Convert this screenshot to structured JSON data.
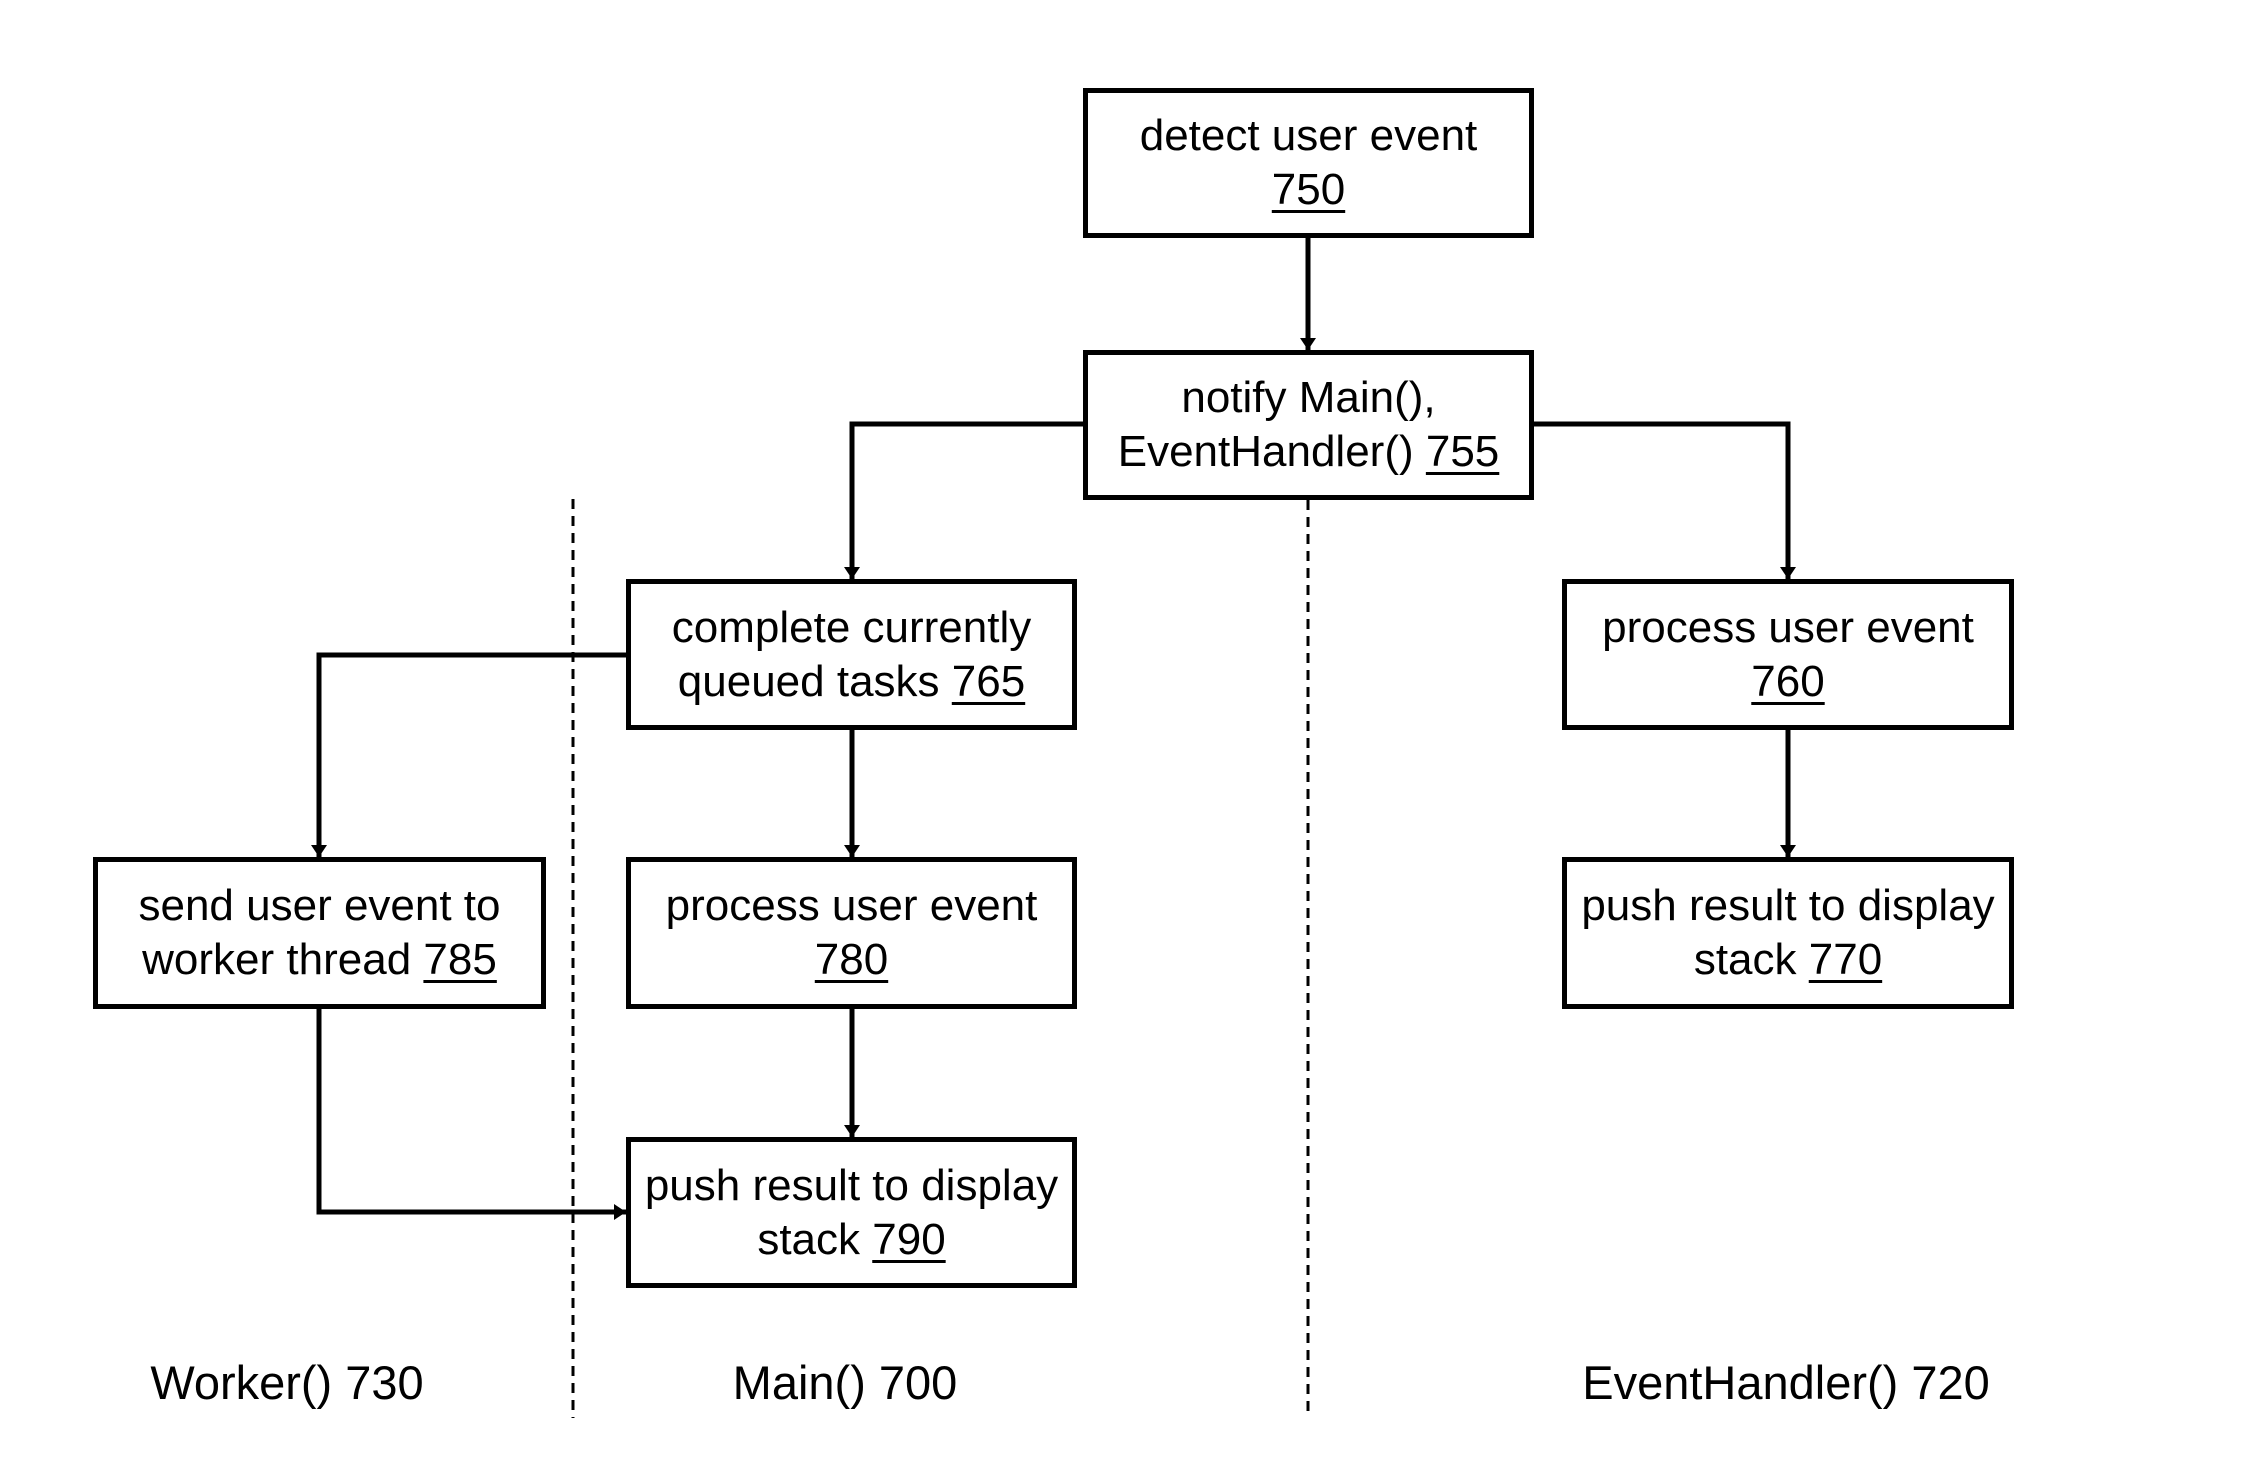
{
  "diagram": {
    "type": "flowchart",
    "colors": {
      "stroke": "#000000",
      "background": "#ffffff"
    },
    "lanes": [
      {
        "id": "worker",
        "label": "Worker() 730"
      },
      {
        "id": "main",
        "label": "Main() 700"
      },
      {
        "id": "eventhandler",
        "label": "EventHandler() 720"
      }
    ],
    "nodes": {
      "n750": {
        "text": "detect user event",
        "ref": "750"
      },
      "n755": {
        "text": "notify Main(), EventHandler()",
        "ref": "755"
      },
      "n765": {
        "text": "complete currently queued tasks",
        "ref": "765"
      },
      "n760": {
        "text": "process user event",
        "ref": "760"
      },
      "n785": {
        "text": "send user event to worker thread",
        "ref": "785"
      },
      "n780": {
        "text": "process user event",
        "ref": "780"
      },
      "n770": {
        "text": "push result to display stack",
        "ref": "770"
      },
      "n790": {
        "text": "push result to display stack",
        "ref": "790"
      }
    },
    "edges": [
      {
        "from": "750",
        "to": "755"
      },
      {
        "from": "755",
        "to": "765"
      },
      {
        "from": "755",
        "to": "760"
      },
      {
        "from": "765",
        "to": "785"
      },
      {
        "from": "765",
        "to": "780"
      },
      {
        "from": "780",
        "to": "790"
      },
      {
        "from": "785",
        "to": "790"
      },
      {
        "from": "760",
        "to": "770"
      }
    ]
  }
}
